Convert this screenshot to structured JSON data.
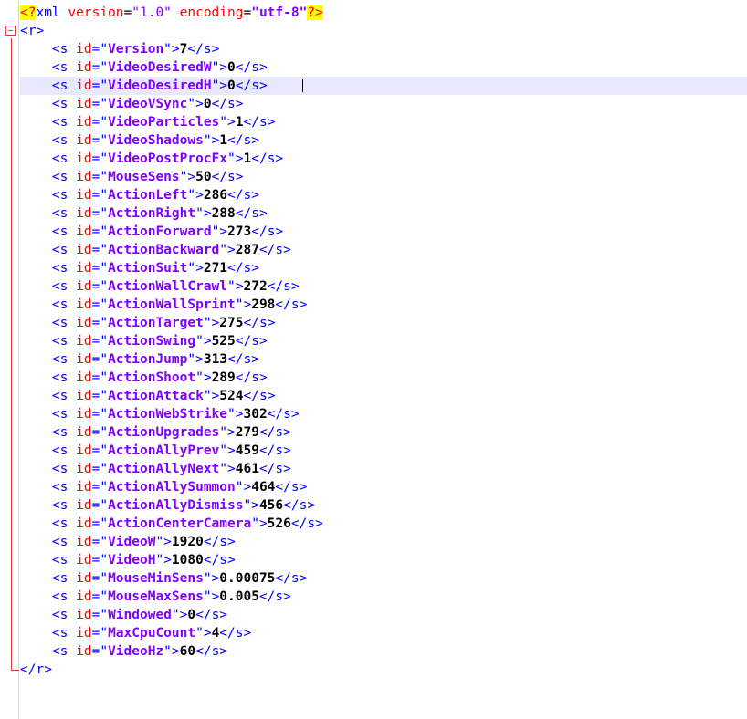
{
  "document": {
    "xml_declaration": {
      "open": "<?",
      "name": "xml",
      "version_attr": "version",
      "version_value": "\"1.0\"",
      "encoding_attr": "encoding",
      "encoding_value": "\"utf-8\"",
      "close": "?>"
    },
    "root_open": "<r>",
    "root_close": "</r>",
    "element_open": "<s",
    "element_close": "</s>",
    "attribute_name": "id",
    "entries": [
      {
        "id": "Version",
        "value": "7"
      },
      {
        "id": "VideoDesiredW",
        "value": "0"
      },
      {
        "id": "VideoDesiredH",
        "value": "0"
      },
      {
        "id": "VideoVSync",
        "value": "0"
      },
      {
        "id": "VideoParticles",
        "value": "1"
      },
      {
        "id": "VideoShadows",
        "value": "1"
      },
      {
        "id": "VideoPostProcFx",
        "value": "1"
      },
      {
        "id": "MouseSens",
        "value": "50"
      },
      {
        "id": "ActionLeft",
        "value": "286"
      },
      {
        "id": "ActionRight",
        "value": "288"
      },
      {
        "id": "ActionForward",
        "value": "273"
      },
      {
        "id": "ActionBackward",
        "value": "287"
      },
      {
        "id": "ActionSuit",
        "value": "271"
      },
      {
        "id": "ActionWallCrawl",
        "value": "272"
      },
      {
        "id": "ActionWallSprint",
        "value": "298"
      },
      {
        "id": "ActionTarget",
        "value": "275"
      },
      {
        "id": "ActionSwing",
        "value": "525"
      },
      {
        "id": "ActionJump",
        "value": "313"
      },
      {
        "id": "ActionShoot",
        "value": "289"
      },
      {
        "id": "ActionAttack",
        "value": "524"
      },
      {
        "id": "ActionWebStrike",
        "value": "302"
      },
      {
        "id": "ActionUpgrades",
        "value": "279"
      },
      {
        "id": "ActionAllyPrev",
        "value": "459"
      },
      {
        "id": "ActionAllyNext",
        "value": "461"
      },
      {
        "id": "ActionAllySummon",
        "value": "464"
      },
      {
        "id": "ActionAllyDismiss",
        "value": "456"
      },
      {
        "id": "ActionCenterCamera",
        "value": "526"
      },
      {
        "id": "VideoW",
        "value": "1920"
      },
      {
        "id": "VideoH",
        "value": "1080"
      },
      {
        "id": "MouseMinSens",
        "value": "0.00075"
      },
      {
        "id": "MouseMaxSens",
        "value": "0.005"
      },
      {
        "id": "Windowed",
        "value": "0"
      },
      {
        "id": "MaxCpuCount",
        "value": "4"
      },
      {
        "id": "VideoHz",
        "value": "60"
      }
    ],
    "current_line_entry_index": 2
  },
  "colors": {
    "tag": "#0000ff",
    "attribute_name": "#ff0000",
    "attribute_value": "#8000ff",
    "text": "#000000",
    "declaration_highlight": "#ffff00",
    "fold_marker": "#e23a3a",
    "current_line": "#e8e8ff"
  }
}
